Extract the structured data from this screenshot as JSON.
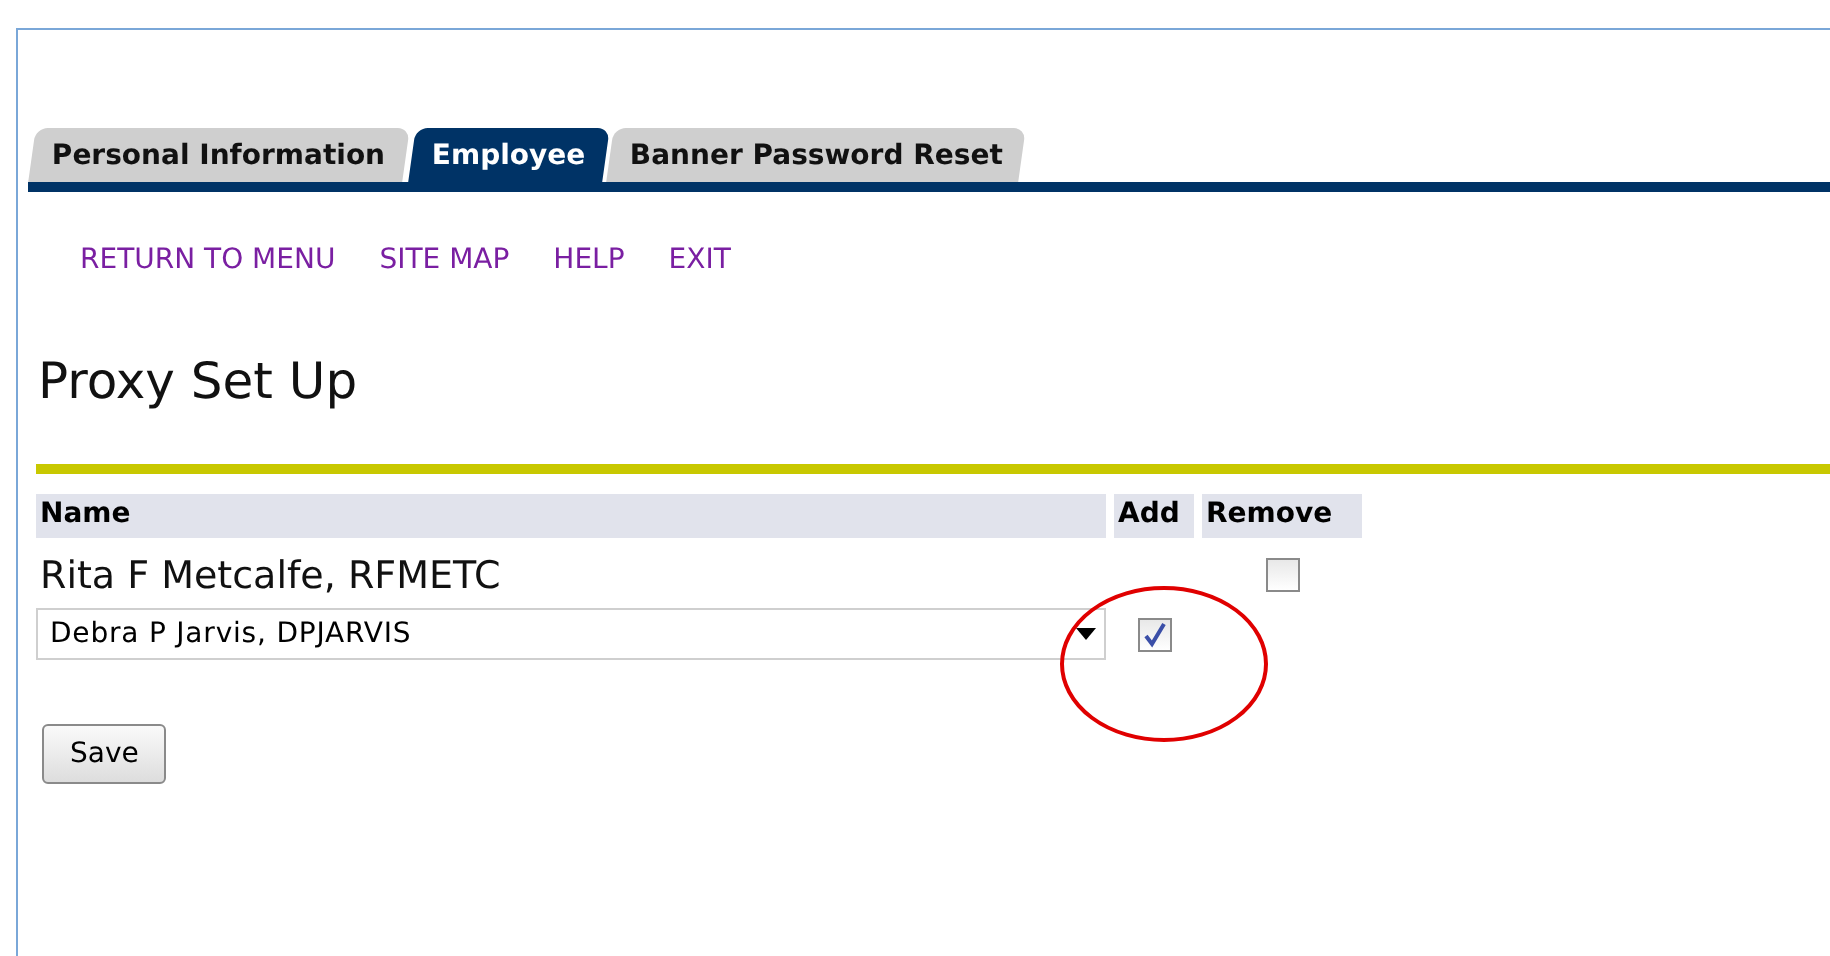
{
  "tabs": [
    {
      "label": "Personal Information",
      "selected": false
    },
    {
      "label": "Employee",
      "selected": true
    },
    {
      "label": "Banner Password Reset",
      "selected": false
    }
  ],
  "nav_links": [
    "RETURN TO MENU",
    "SITE MAP",
    "HELP",
    "EXIT"
  ],
  "page_title": "Proxy Set Up",
  "table": {
    "columns": [
      "Name",
      "Add",
      "Remove"
    ],
    "rows": [
      {
        "kind": "text",
        "name": "Rita F Metcalfe, RFMETC",
        "remove": {
          "checked": false
        }
      },
      {
        "kind": "select",
        "value": "Debra P Jarvis, DPJARVIS",
        "add": {
          "checked": true
        }
      }
    ]
  },
  "save_button": "Save"
}
